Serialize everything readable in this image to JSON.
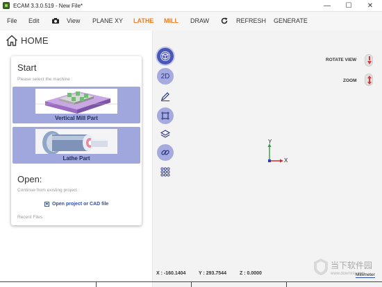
{
  "window": {
    "title": "ECAM 3.3.0.519 - New File*",
    "min_glyph": "—",
    "max_glyph": "☐",
    "close_glyph": "✕"
  },
  "menu": {
    "file": "File",
    "edit": "Edit",
    "view": "View",
    "plane": "PLANE XY",
    "lathe": "LATHE",
    "mill": "MILL",
    "draw": "DRAW",
    "refresh": "REFRESH",
    "generate": "GENERATE",
    "highlight_color": "#f07c22"
  },
  "home": {
    "label": "HOME",
    "start_title": "Start",
    "start_hint": "Please select the machine :",
    "tiles": [
      {
        "label": "Vertical Mill Part",
        "color": "#9fa7dc"
      },
      {
        "label": "Lathe Part",
        "color": "#9fa7dc"
      }
    ],
    "open_title": "Open:",
    "open_hint": "Continue from existing project :",
    "open_link": "Open project or CAD file",
    "recent_label": "Recent Files :"
  },
  "tools": {
    "twod_label": "2D"
  },
  "view_controls": {
    "rotate": "ROTATE VIEW",
    "zoom": "ZOOM"
  },
  "axes": {
    "x": "X",
    "y": "Y",
    "x_color": "#d42a2a",
    "y_color": "#2e9e3a",
    "z_color": "#2b3fc4"
  },
  "status": {
    "x": "X : -160.1404",
    "y": "Y : 293.7544",
    "z": "Z : 0.0000",
    "unit": "Millimeter"
  },
  "watermark": {
    "name": "当下软件园",
    "url": "www.downxia.com"
  }
}
